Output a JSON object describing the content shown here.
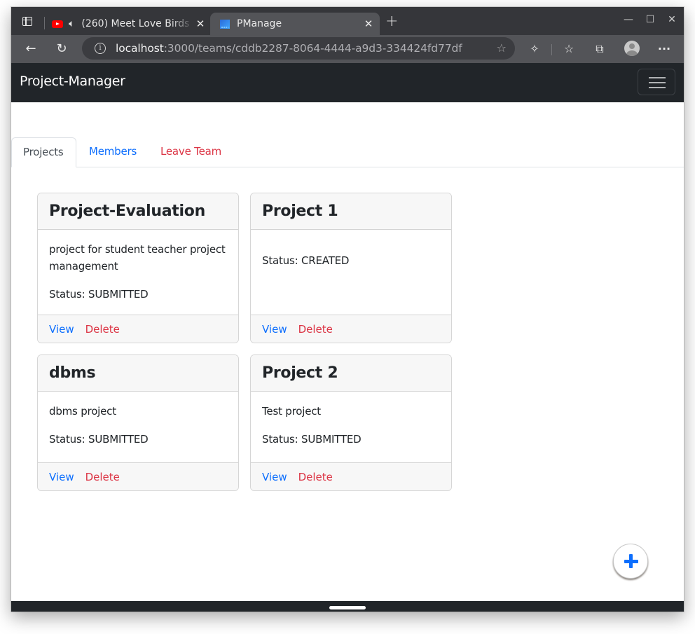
{
  "browser": {
    "tabs": [
      {
        "title": "(260) Meet Love Birds",
        "favicon": "youtube-icon",
        "audio": "speaker-icon",
        "active": false
      },
      {
        "title": "PManage",
        "favicon": "pmanage-favicon",
        "active": true
      }
    ],
    "close_glyph": "✕",
    "new_tab_glyph": "+",
    "window_controls": {
      "minimize": "—",
      "maximize": "☐",
      "close": "✕"
    },
    "nav": {
      "back": "←",
      "reload": "↻"
    },
    "address": {
      "host": "localhost",
      "rest": ":3000/teams/cddb2287-8064-4444-a9d3-334424fd77df",
      "info_glyph": "i"
    },
    "toolbar_icons": {
      "favorite_add": "☆",
      "extensions": "✧",
      "favorites": "☆",
      "collections": "⧉",
      "more": "···"
    }
  },
  "app": {
    "brand": "Project-Manager",
    "tabs": [
      {
        "label": "Projects",
        "active": true
      },
      {
        "label": "Members",
        "active": false
      },
      {
        "label": "Leave Team",
        "active": false
      }
    ],
    "projects": [
      {
        "title": "Project-Evaluation",
        "description": "project for student teacher project management",
        "status": "Status: SUBMITTED",
        "view": "View",
        "delete": "Delete"
      },
      {
        "title": "Project 1",
        "description": "",
        "status": "Status: CREATED",
        "view": "View",
        "delete": "Delete"
      },
      {
        "title": "dbms",
        "description": "dbms project",
        "status": "Status: SUBMITTED",
        "view": "View",
        "delete": "Delete"
      },
      {
        "title": "Project 2",
        "description": "Test project",
        "status": "Status: SUBMITTED",
        "view": "View",
        "delete": "Delete"
      }
    ],
    "colors": {
      "primary": "#0d6efd",
      "danger": "#dc3545",
      "navbar": "#212529"
    }
  }
}
